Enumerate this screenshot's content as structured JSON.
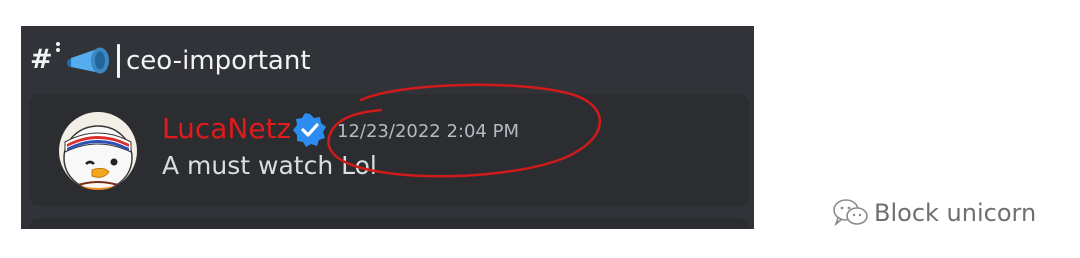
{
  "channel": {
    "hash_icon": "hash-icon",
    "emoji_icon": "megaphone-icon",
    "name": "ceo-important"
  },
  "message": {
    "author": "LucaNetz",
    "author_color": "#e11b1b",
    "verified_icon": "verified-badge-icon",
    "timestamp": "12/23/2022 2:04 PM",
    "content": "A must watch Lol"
  },
  "annotation": {
    "color": "#d11a1a",
    "shape": "hand-drawn ellipse around timestamp"
  },
  "watermark": {
    "icon": "wechat-icon",
    "text": "Block unicorn"
  }
}
